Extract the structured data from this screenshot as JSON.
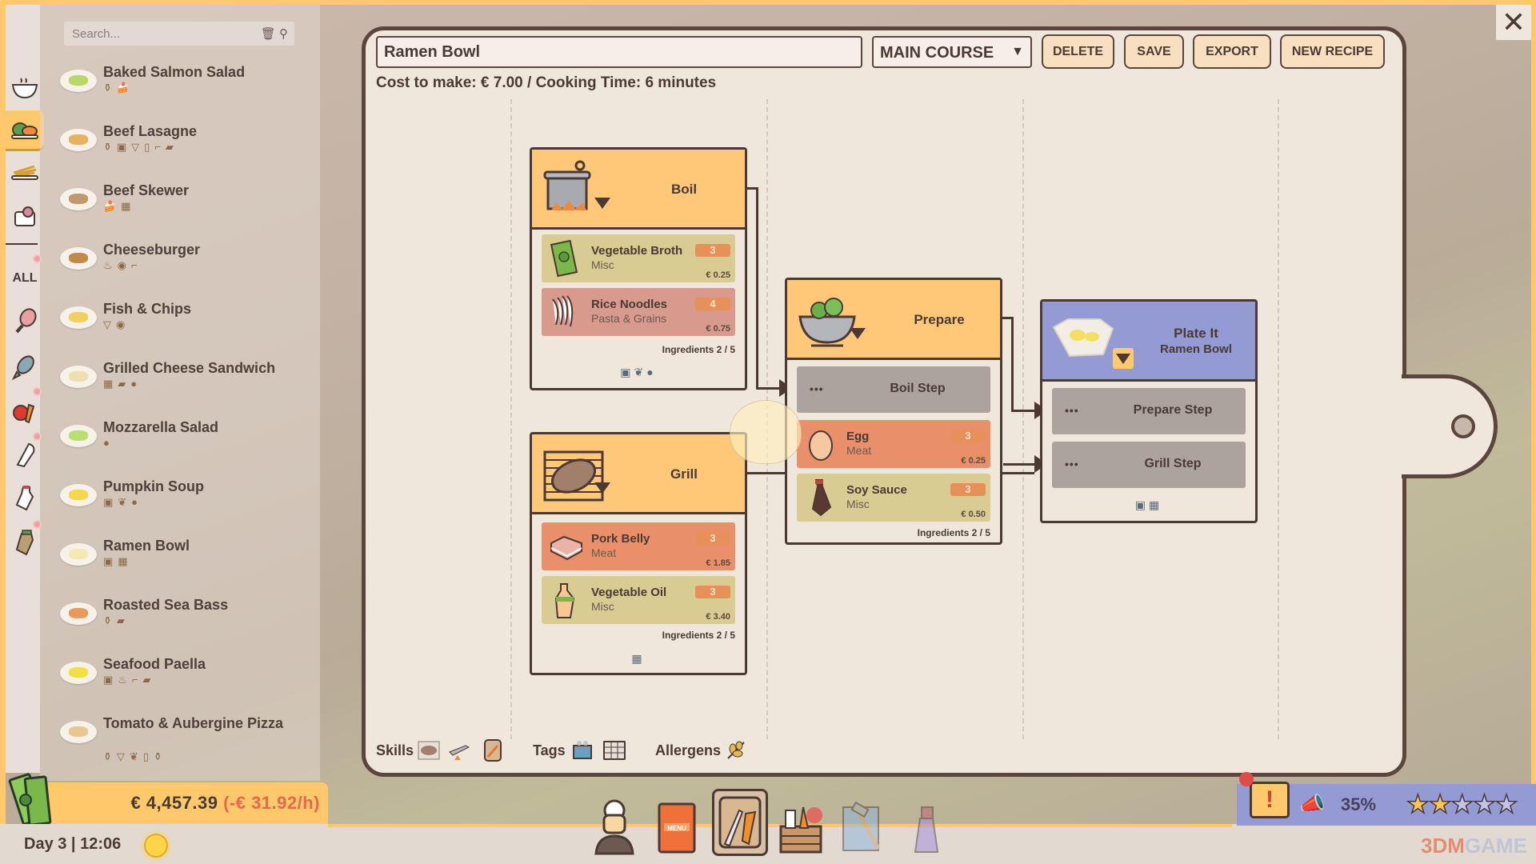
{
  "rail": {
    "items": [
      {
        "name": "soups",
        "icon": "bowl-icon"
      },
      {
        "name": "main-courses",
        "icon": "salad-plate-icon",
        "active": true
      },
      {
        "name": "sides",
        "icon": "fries-plate-icon"
      },
      {
        "name": "desserts",
        "icon": "dessert-icon"
      }
    ],
    "all_label": "ALL",
    "filters": [
      "meat-icon",
      "fish-icon",
      "vegetables-icon",
      "bread-icon",
      "milk-icon",
      "jar-icon"
    ]
  },
  "search": {
    "placeholder": "Search..."
  },
  "recipes": [
    {
      "name": "Baked Salmon Salad",
      "tags": "⚱🍰",
      "food": "#b8d86a"
    },
    {
      "name": "Beef Lasagne",
      "tags": "⚱▣▽▯⌐▰",
      "food": "#e6b260"
    },
    {
      "name": "Beef Skewer",
      "tags": "🍰▦",
      "food": "#c09a6a"
    },
    {
      "name": "Cheeseburger",
      "tags": "♨◉⌐",
      "food": "#c08a4a"
    },
    {
      "name": "Fish & Chips",
      "tags": "▽◉",
      "food": "#f0d060"
    },
    {
      "name": "Grilled Cheese Sandwich",
      "tags": "▦▰●",
      "food": "#ece0b0"
    },
    {
      "name": "Mozzarella Salad",
      "tags": "●",
      "food": "#b8e070"
    },
    {
      "name": "Pumpkin Soup",
      "tags": "▣❦●",
      "food": "#f4d84a"
    },
    {
      "name": "Ramen Bowl",
      "tags": "▣▦",
      "food": "#f2eab0"
    },
    {
      "name": "Roasted Sea Bass",
      "tags": "⚱▰",
      "food": "#e89a5a"
    },
    {
      "name": "Seafood Paella",
      "tags": "▣♨⌐▰",
      "food": "#f2e040"
    },
    {
      "name": "Tomato & Aubergine Pizza",
      "tags": "⚱▽❦▯⚱",
      "food": "#e8c890"
    }
  ],
  "money": {
    "balance": "€ 4,457.39",
    "rate": "(-€ 31.92/h)"
  },
  "clock": {
    "text": "Day 3 | 12:06"
  },
  "editor": {
    "recipe_name": "Ramen Bowl",
    "course": "MAIN COURSE",
    "buttons": {
      "delete": "DELETE",
      "save": "SAVE",
      "export": "EXPORT",
      "new": "NEW RECIPE"
    },
    "cost_line": "Cost to make: € 7.00 / Cooking Time: 6 minutes",
    "steps": {
      "boil": {
        "title": "Boil",
        "ingredients": [
          {
            "name": "Vegetable Broth",
            "category": "Misc",
            "qty": "3",
            "price": "€ 0.25"
          },
          {
            "name": "Rice Noodles",
            "category": "Pasta & Grains",
            "qty": "4",
            "price": "€ 0.75"
          }
        ],
        "count": "Ingredients  2 / 5",
        "tags": "▣❦●"
      },
      "grill": {
        "title": "Grill",
        "ingredients": [
          {
            "name": "Pork Belly",
            "category": "Meat",
            "qty": "3",
            "price": "€ 1.85"
          },
          {
            "name": "Vegetable Oil",
            "category": "Misc",
            "qty": "3",
            "price": "€ 3.40"
          }
        ],
        "count": "Ingredients  2 / 5",
        "tags": "▦"
      },
      "prepare": {
        "title": "Prepare",
        "substeps": [
          {
            "dots": "•••",
            "name": "Boil Step"
          }
        ],
        "ingredients": [
          {
            "name": "Egg",
            "category": "Meat",
            "qty": "3",
            "price": "€ 0.25"
          },
          {
            "name": "Soy Sauce",
            "category": "Misc",
            "qty": "3",
            "price": "€ 0.50"
          }
        ],
        "count": "Ingredients  2 / 5"
      },
      "plate": {
        "title": "Plate It",
        "subtitle": "Ramen Bowl",
        "substeps": [
          {
            "dots": "•••",
            "name": "Prepare Step"
          },
          {
            "dots": "•••",
            "name": "Grill Step"
          }
        ],
        "tags": "▣▦"
      }
    },
    "footer": {
      "skills": "Skills",
      "tags": "Tags",
      "allergens": "Allergens"
    }
  },
  "toolbar": {
    "items": [
      "staff",
      "menu",
      "recipes",
      "ingredients",
      "build",
      "cleaning"
    ],
    "active": "recipes",
    "menu_label": "MENU"
  },
  "reputation": {
    "percent": "35%",
    "stars": 2,
    "max_stars": 5
  },
  "close": "✕",
  "watermark": {
    "a": "3DM",
    "b": "GAME"
  }
}
